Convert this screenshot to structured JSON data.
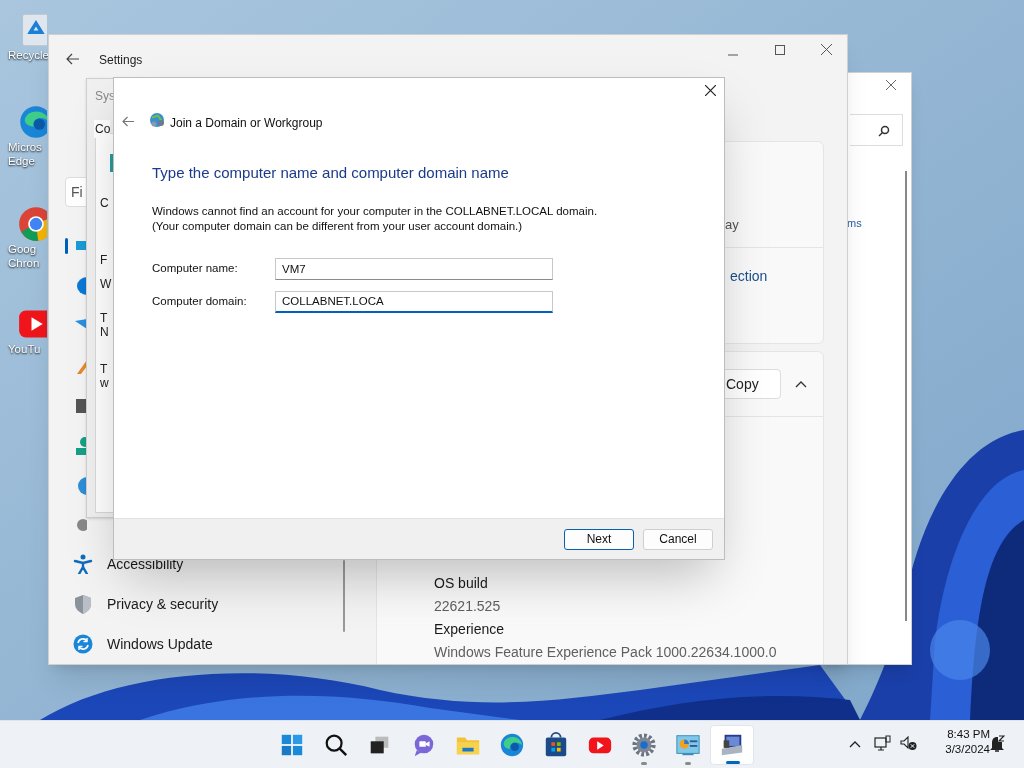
{
  "desktop_icons": [
    {
      "kind": "recycle_bin",
      "lines": [
        "Recycle"
      ]
    },
    {
      "kind": "edge",
      "lines": [
        "Micros",
        "Edge"
      ]
    },
    {
      "kind": "chrome",
      "lines": [
        "Goog",
        "Chron"
      ]
    },
    {
      "kind": "youtube",
      "lines": [
        "YouTu"
      ]
    }
  ],
  "back_window": {
    "link_fragment": "ms"
  },
  "settings_window": {
    "title": "Settings",
    "search_placeholder": "Fi",
    "nav": [
      {
        "kind": "accessibility",
        "label": "Accessibility"
      },
      {
        "kind": "privacy",
        "label": "Privacy & security"
      },
      {
        "kind": "update",
        "label": "Windows Update"
      }
    ],
    "text_fragment": "ay",
    "link_fragment": "ection",
    "copy_button": "Copy",
    "specs": [
      {
        "label": "OS build",
        "value": "22621.525"
      },
      {
        "label": "Experience",
        "value": "Windows Feature Experience Pack 1000.22634.1000.0"
      }
    ]
  },
  "system_properties_window": {
    "title": "Sys",
    "tab": "Co",
    "fragments": [
      "C",
      "F",
      "W",
      "T",
      "N",
      "T",
      "w"
    ]
  },
  "dialog": {
    "title": "Join a Domain or Workgroup",
    "heading": "Type the computer name and computer domain name",
    "message_lines": [
      "Windows cannot find an account for your computer in the COLLABNET.LOCAL domain.",
      "(Your computer domain can be different from your user account domain.)"
    ],
    "fields": [
      {
        "label": "Computer name:",
        "value": "VM7",
        "focused": false
      },
      {
        "label": "Computer domain:",
        "value": "COLLABNET.LOCA",
        "focused": true
      }
    ],
    "buttons": [
      {
        "label": "Next",
        "default": true
      },
      {
        "label": "Cancel",
        "default": false
      }
    ]
  },
  "taskbar": {
    "items": [
      {
        "kind": "start",
        "open": false,
        "selected": false
      },
      {
        "kind": "search",
        "open": false,
        "selected": false
      },
      {
        "kind": "taskview",
        "open": false,
        "selected": false
      },
      {
        "kind": "chat",
        "open": false,
        "selected": false
      },
      {
        "kind": "explorer",
        "open": false,
        "selected": false
      },
      {
        "kind": "edge",
        "open": false,
        "selected": false
      },
      {
        "kind": "store",
        "open": false,
        "selected": false
      },
      {
        "kind": "youtube",
        "open": false,
        "selected": false
      },
      {
        "kind": "settings",
        "open": true,
        "selected": false
      },
      {
        "kind": "control_panel",
        "open": true,
        "selected": false
      },
      {
        "kind": "system",
        "open": true,
        "selected": true
      }
    ],
    "time": "8:43 PM",
    "date": "3/3/2024"
  }
}
